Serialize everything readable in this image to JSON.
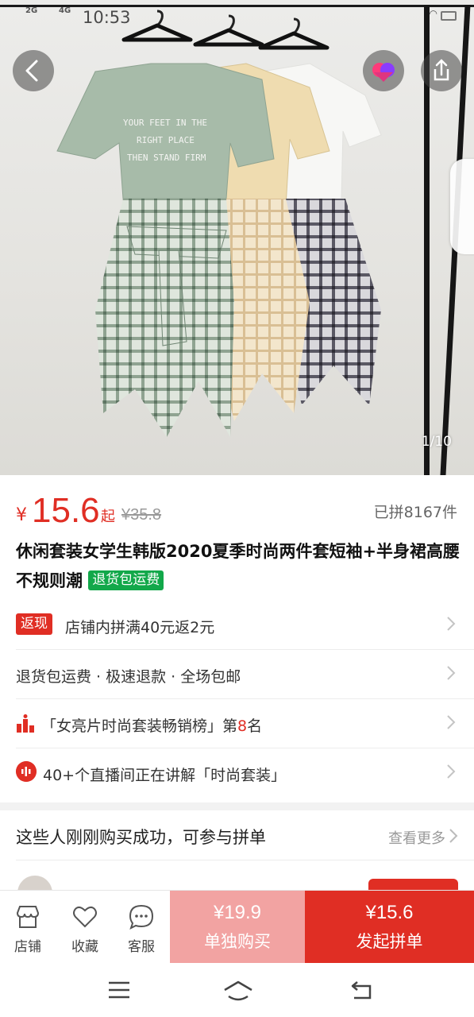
{
  "status_bar": {
    "network_1": "2G",
    "network_2": "4G",
    "time": "10:53",
    "battery": "6"
  },
  "gallery": {
    "counter": "1/10",
    "shirt_print_lines": [
      "YOUR FEET IN THE",
      "RIGHT PLACE",
      "THEN STAND FIRM"
    ]
  },
  "product": {
    "currency": "¥",
    "price": "15.6",
    "price_suffix": "起",
    "original_price": "¥35.8",
    "sold_count": "已拼8167件",
    "title": "休闲套装女学生韩版2020夏季时尚两件套短袖+半身裙高腰不规则潮",
    "title_tag": "退货包运费"
  },
  "rows": {
    "cashback_badge": "返现",
    "cashback_text": "店铺内拼满40元返2元",
    "services_text": "退货包运费 · 极速退款 · 全场包邮",
    "rank_text_pre": "「女亮片时尚套装畅销榜」第",
    "rank_number": "8",
    "rank_text_post": "名",
    "live_text": "40+个直播间正在讲解「时尚套装」"
  },
  "group": {
    "title": "这些人刚刚购买成功，可参与拼单",
    "more": "查看更多"
  },
  "bottom_bar": {
    "store": "店铺",
    "favorite": "收藏",
    "service": "客服",
    "alone_price": "¥19.9",
    "alone_label": "单独购买",
    "group_price": "¥15.6",
    "group_label": "发起拼单"
  },
  "colors": {
    "brand_red": "#e02e24",
    "green_tag": "#12a84a"
  }
}
